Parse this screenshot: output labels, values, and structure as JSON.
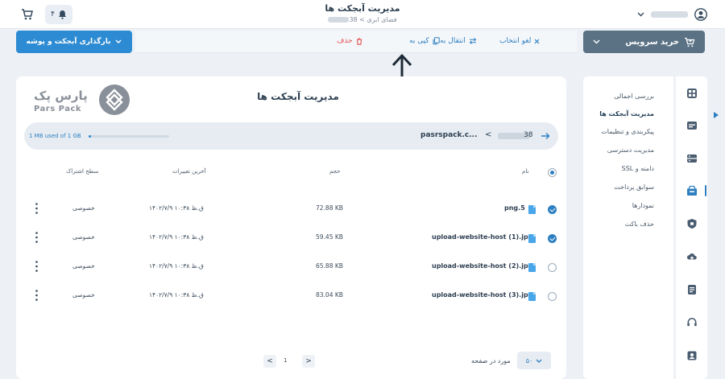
{
  "header": {
    "title": "مدیریت آبجکت ها",
    "breadcrumb_parent": "فضای ابری",
    "breadcrumb_sep": "<",
    "breadcrumb_suffix": "38",
    "notification_count": "۴"
  },
  "toolbar": {
    "upload_label": "بارگذاری آبجکت و پوشه",
    "delete_label": "حذف",
    "copy_label": "کپی به",
    "move_label": "انتقال به",
    "cancel_label": "لغو انتخاب",
    "buy_label": "خرید سرویس"
  },
  "sidebar": {
    "items": [
      {
        "label": "بررسی اجمالی",
        "active": false
      },
      {
        "label": "مدیریت آبجکت ها",
        "active": true
      },
      {
        "label": "پیکربندی و تنظیمات",
        "active": false
      },
      {
        "label": "مدیریت دسترسی",
        "active": false
      },
      {
        "label": "دامنه و SSL",
        "active": false
      },
      {
        "label": "سوابق پرداخت",
        "active": false
      },
      {
        "label": "نمودارها",
        "active": false
      },
      {
        "label": "حذف باکت",
        "active": false
      }
    ],
    "icons": [
      "dashboard-icon",
      "server-icon",
      "storage-icon",
      "bucket-icon",
      "shield-icon",
      "cloud-icon",
      "document-icon",
      "headset-icon",
      "user-icon"
    ]
  },
  "main": {
    "logo_fa": "پارس پک",
    "logo_en": "Pars Pack",
    "title": "مدیریت آبجکت ها",
    "usage_label": "1 MB used of 1 GB",
    "usage_fraction": 0.001,
    "path_bucket": "pasrspack.c...",
    "path_sep": "<",
    "path_suffix": "38",
    "columns": {
      "name": "نام",
      "size": "حجم",
      "modified": "آخرین تغییرات",
      "share": "سطح اشتراک"
    },
    "rows": [
      {
        "name": "png.5",
        "size": "72.88 KB",
        "modified": "۱۴۰۲/۷/۹ ۱۰:۳۸ ق.ظ",
        "share": "خصوصی",
        "checked": true
      },
      {
        "name": "upload-website-host (1).jpg",
        "size": "59.45 KB",
        "modified": "۱۴۰۲/۷/۹ ۱۰:۳۸ ق.ظ",
        "share": "خصوصی",
        "checked": true
      },
      {
        "name": "upload-website-host (2).jpg",
        "size": "65.88 KB",
        "modified": "۱۴۰۲/۷/۹ ۱۰:۳۸ ق.ظ",
        "share": "خصوصی",
        "checked": false
      },
      {
        "name": "upload-website-host (3).jpg",
        "size": "83.04 KB",
        "modified": "۱۴۰۲/۷/۹ ۱۰:۳۸ ق.ظ",
        "share": "خصوصی",
        "checked": false
      }
    ],
    "pagination": {
      "current_page": "1",
      "prev": "<",
      "next": ">",
      "per_page_label": "مورد در صفحه",
      "per_page_value": "۵۰"
    }
  },
  "colors": {
    "accent": "#2d7fc1",
    "primary_button": "#2d8bd3",
    "buy_button": "#5b7285",
    "danger": "#e04b4b"
  }
}
